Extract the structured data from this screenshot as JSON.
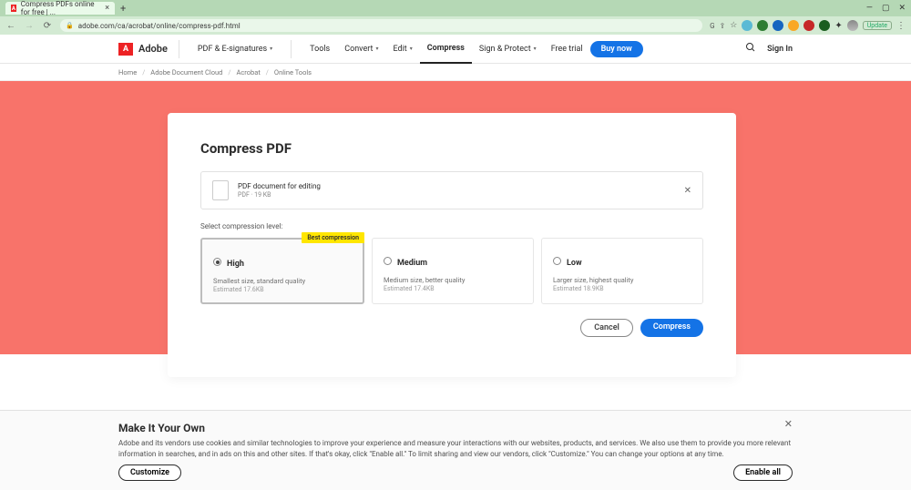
{
  "browser": {
    "tab_title": "Compress PDFs online for free | ...",
    "url": "adobe.com/ca/acrobat/online/compress-pdf.html",
    "update_label": "Update",
    "win": {
      "min": "—",
      "max": "▢",
      "close": "✕"
    }
  },
  "header": {
    "brand": "Adobe",
    "menu": [
      "PDF & E-signatures",
      "Tools",
      "Convert",
      "Edit",
      "Compress",
      "Sign & Protect",
      "Free trial"
    ],
    "dropdown_idx": [
      0,
      2,
      3,
      5
    ],
    "active_idx": 4,
    "buy": "Buy now",
    "sign_in": "Sign In"
  },
  "breadcrumb": [
    "Home",
    "Adobe Document Cloud",
    "Acrobat",
    "Online Tools"
  ],
  "card": {
    "title": "Compress PDF",
    "file": {
      "name": "PDF document for editing",
      "size": "PDF · 19 KB"
    },
    "level_label": "Select compression level:",
    "options": [
      {
        "title": "High",
        "sub": "Smallest size, standard quality",
        "est": "Estimated 17.6KB",
        "selected": true,
        "badge": "Best compression"
      },
      {
        "title": "Medium",
        "sub": "Medium size, better quality",
        "est": "Estimated 17.4KB",
        "selected": false
      },
      {
        "title": "Low",
        "sub": "Larger size, highest quality",
        "est": "Estimated 18.9KB",
        "selected": false
      }
    ],
    "cancel": "Cancel",
    "compress": "Compress"
  },
  "cookie": {
    "title": "Make It Your Own",
    "body": "Adobe and its vendors use cookies and similar technologies to improve your experience and measure your interactions with our websites, products, and services. We also use them to provide you more relevant information in searches, and in ads on this and other sites. If that's okay, click \"Enable all.\" To limit sharing and view our vendors, click \"Customize.\" You can change your options at any time.",
    "customize": "Customize",
    "enable": "Enable all"
  }
}
